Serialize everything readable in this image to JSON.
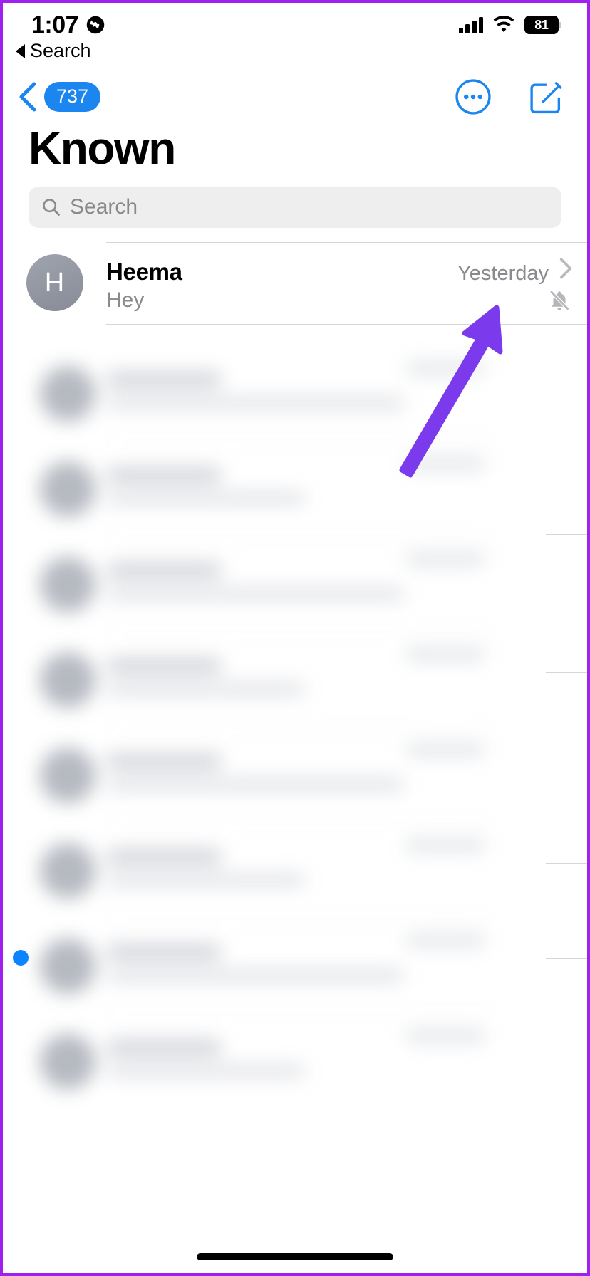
{
  "status_bar": {
    "time": "1:07",
    "location_icon": "globe-icon",
    "battery_percent": "81",
    "signal_icon": "cellular-signal-icon",
    "wifi_icon": "wifi-icon"
  },
  "back_to_app": {
    "label": "Search",
    "icon": "back-triangle-icon"
  },
  "nav_bar": {
    "back_icon": "chevron-left-icon",
    "unread_count": "737",
    "more_icon": "ellipsis-circle-icon",
    "compose_icon": "compose-icon"
  },
  "page": {
    "title": "Known"
  },
  "search": {
    "placeholder": "Search",
    "value": "",
    "icon": "search-icon"
  },
  "conversations": [
    {
      "avatar_initial": "H",
      "name": "Heema",
      "time": "Yesterday",
      "preview": "Hey",
      "muted": true,
      "mute_icon": "bell-slash-icon",
      "disclosure_icon": "chevron-right-icon"
    }
  ],
  "annotation": {
    "arrow_color": "#7C3AED",
    "points_to": "bell-slash-icon"
  },
  "colors": {
    "accent_blue": "#1b85f0",
    "unread_dot": "#0a84ff",
    "secondary_text": "#8a8a8e",
    "search_background": "#eeeeef",
    "frame_border": "#a020f0"
  }
}
